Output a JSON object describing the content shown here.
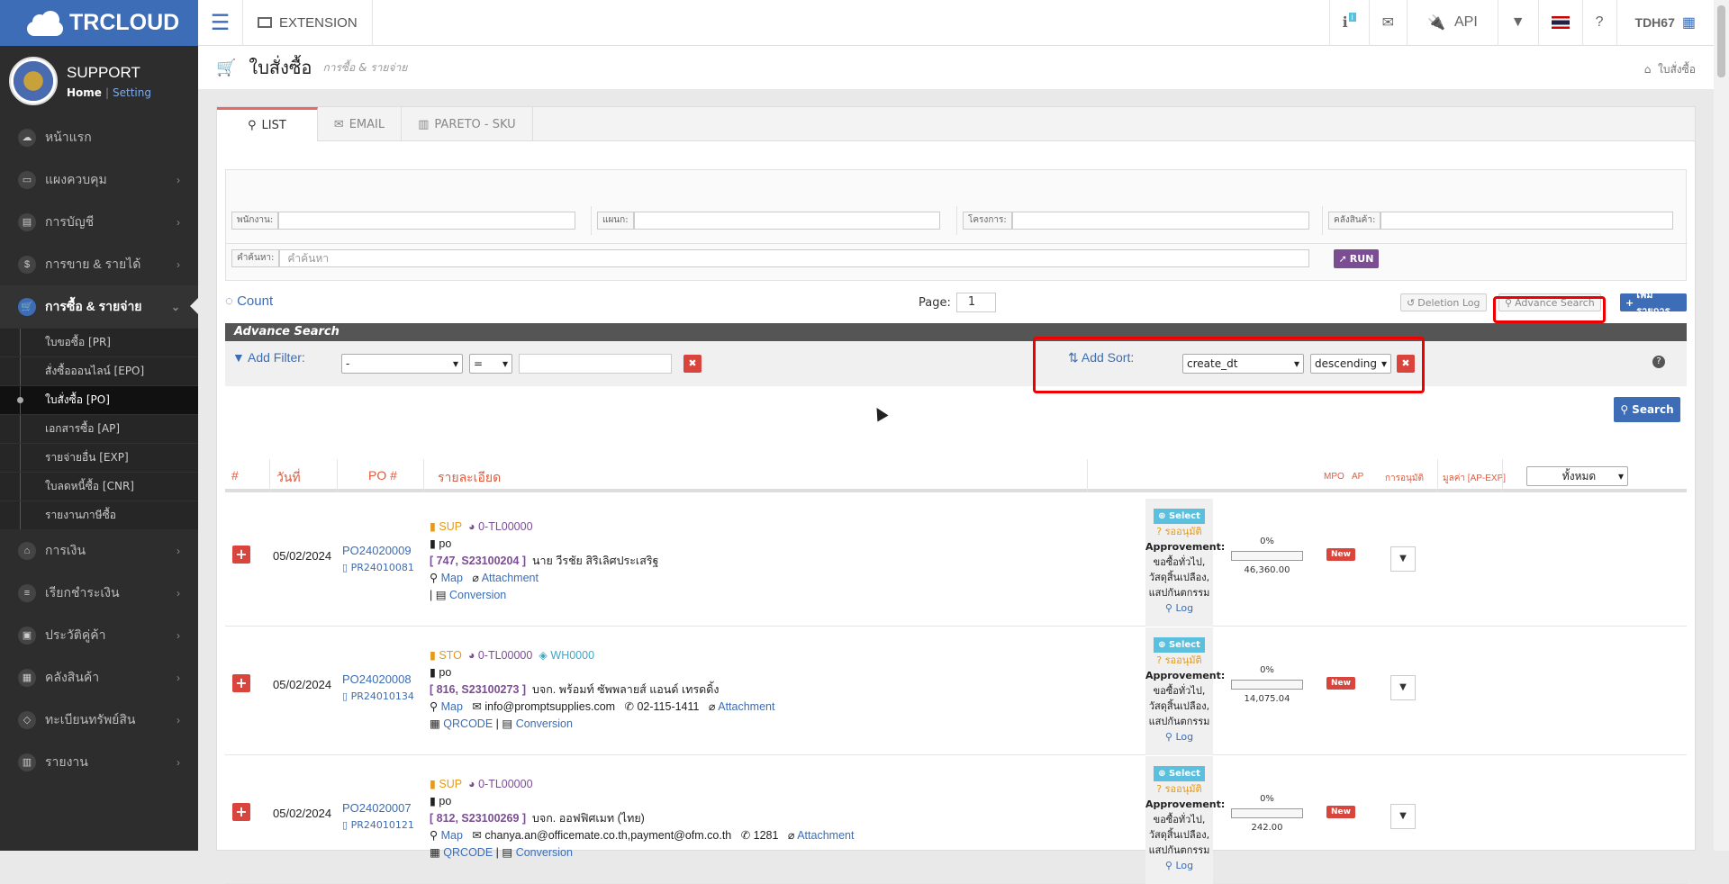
{
  "brand": {
    "name": "TRCLOUD"
  },
  "profile": {
    "name": "SUPPORT",
    "home": "Home",
    "setting": "Setting"
  },
  "menu": [
    {
      "label": "หน้าแรก",
      "icon": "cloud-icon"
    },
    {
      "label": "แผงควบคุม",
      "icon": "monitor-icon"
    },
    {
      "label": "การบัญชี",
      "icon": "book-icon"
    },
    {
      "label": "การขาย & รายได้",
      "icon": "dollar-icon"
    },
    {
      "label": "การซื้อ & รายจ่าย",
      "icon": "cart-icon"
    },
    {
      "label": "การเงิน",
      "icon": "bank-icon"
    },
    {
      "label": "เรียกชำระเงิน",
      "icon": "receipt-icon"
    },
    {
      "label": "ประวัติคู่ค้า",
      "icon": "contact-icon"
    },
    {
      "label": "คลังสินค้า",
      "icon": "cubes-icon"
    },
    {
      "label": "ทะเบียนทรัพย์สิน",
      "icon": "diamond-icon"
    },
    {
      "label": "รายงาน",
      "icon": "report-icon"
    }
  ],
  "submenu": [
    "ใบขอซื้อ [PR]",
    "สั่งซื้อออนไลน์ [EPO]",
    "ใบสั่งซื้อ [PO]",
    "เอกสารซื้อ [AP]",
    "รายจ่ายอื่น [EXP]",
    "ใบลดหนี้ซื้อ [CNR]",
    "รายงานภาษีซื้อ"
  ],
  "topbar": {
    "extension": "EXTENSION",
    "api": "API",
    "user": "TDH67",
    "info_badge": "i"
  },
  "page": {
    "title": "ใบสั่งซื้อ",
    "subtitle": "การซื้อ & รายจ่าย",
    "breadcrumb": "ใบสั่งซื้อ"
  },
  "tabs": [
    "LIST",
    "EMAIL",
    "PARETO - SKU"
  ],
  "filters": {
    "employee": "พนักงาน:",
    "department": "แผนก:",
    "project": "โครงการ:",
    "warehouse": "คลังสินค้า:",
    "search_label": "คำค้นหา:",
    "search_placeholder": "คำค้นหา",
    "run": "RUN"
  },
  "toolbar": {
    "count": "Count",
    "page_label": "Page:",
    "page_value": "1",
    "deletion_log": "Deletion Log",
    "advance_search": "Advance Search",
    "add_item": "เพิ่มรายการ"
  },
  "advance": {
    "title": "Advance Search",
    "add_filter": "Add Filter:",
    "filter_field": "-",
    "filter_op": "=",
    "add_sort": "Add Sort:",
    "sort_field": "create_dt",
    "sort_dir": "descending",
    "search": "Search"
  },
  "table": {
    "headers": [
      "#",
      "วันที่",
      "PO #",
      "รายละเอียด",
      "MPO",
      "AP",
      "การอนุมัติ",
      "มูลค่า [AP-EXP]"
    ],
    "status_filter": "ทั้งหมด",
    "rows": [
      {
        "date": "05/02/2024",
        "po": "PO24020009",
        "pr": "PR24010081",
        "tag": "SUP",
        "code": "0-TL00000",
        "wh": "",
        "doc": "po",
        "ref": "[ 747, S23100204 ]",
        "vendor": "นาย วีรชัย สิริเลิศประเสริฐ",
        "map": "Map",
        "email": "",
        "phone": "",
        "attach": "Attachment",
        "qrcode": "",
        "conversion": "Conversion",
        "select": "Select",
        "pending": "รออนุมัติ",
        "approvement": "Approvement:",
        "approve_detail": "ขอซื้อทั่วไป, วัสดุสิ้นเปลือง, แสปกันตกรรม",
        "log": "Log",
        "progress": "0%",
        "value": "46,360.00",
        "status": "New"
      },
      {
        "date": "05/02/2024",
        "po": "PO24020008",
        "pr": "PR24010134",
        "tag": "STO",
        "code": "0-TL00000",
        "wh": "WH0000",
        "doc": "po",
        "ref": "[ 816, S23100273 ]",
        "vendor": "บจก. พร้อมท์ ซัพพลายส์ แอนด์ เทรดดิ้ง",
        "map": "Map",
        "email": "info@promptsupplies.com",
        "phone": "02-115-1411",
        "attach": "Attachment",
        "qrcode": "QRCODE",
        "conversion": "Conversion",
        "select": "Select",
        "pending": "รออนุมัติ",
        "approvement": "Approvement:",
        "approve_detail": "ขอซื้อทั่วไป, วัสดุสิ้นเปลือง, แสปกันตกรรม",
        "log": "Log",
        "progress": "0%",
        "value": "14,075.04",
        "status": "New"
      },
      {
        "date": "05/02/2024",
        "po": "PO24020007",
        "pr": "PR24010121",
        "tag": "SUP",
        "code": "0-TL00000",
        "wh": "",
        "doc": "po",
        "ref": "[ 812, S23100269 ]",
        "vendor": "บจก. ออฟฟิศเมท (ไทย)",
        "map": "Map",
        "email": "chanya.an@officemate.co.th,payment@ofm.co.th",
        "phone": "1281",
        "attach": "Attachment",
        "qrcode": "QRCODE",
        "conversion": "Conversion",
        "select": "Select",
        "pending": "รออนุมัติ",
        "approvement": "Approvement:",
        "approve_detail": "ขอซื้อทั่วไป, วัสดุสิ้นเปลือง, แสปกันตกรรม",
        "log": "Log",
        "progress": "0%",
        "value": "242.00",
        "status": "New"
      }
    ]
  },
  "colors": {
    "brand": "#3c6db6",
    "sidebar": "#2d2d2d",
    "danger": "#d9453d",
    "accent_header": "#e05a3b",
    "highlight": "#ee0000"
  }
}
